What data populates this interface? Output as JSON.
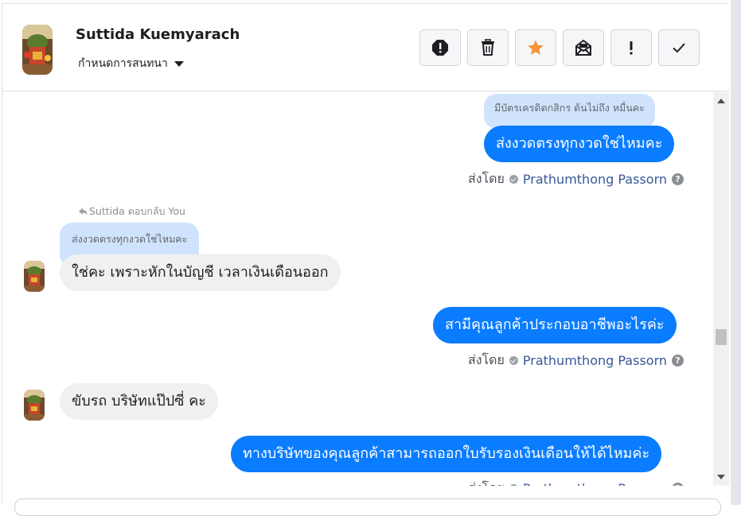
{
  "header": {
    "contact_name": "Suttida Kuemyarach",
    "assign_label": "กำหนดการสนทนา",
    "toolbar": [
      {
        "name": "spam-button",
        "icon": "alert-octagon-icon"
      },
      {
        "name": "delete-button",
        "icon": "trash-icon"
      },
      {
        "name": "star-button",
        "icon": "star-icon",
        "color": "#f7923a"
      },
      {
        "name": "mark-unread-button",
        "icon": "envelope-icon"
      },
      {
        "name": "follow-up-button",
        "icon": "exclamation-icon"
      },
      {
        "name": "mark-done-button",
        "icon": "checkmark-icon"
      }
    ]
  },
  "messages": {
    "m1_quote": "มีบัตรเครดิตกสิกร ต้นไม่ถึง หมื่นคะ",
    "m1_text": "ส่งงวดตรงทุกงวดใช่ไหมคะ",
    "sent_by_label": "ส่งโดย",
    "agent_name": "Prathumthong Passorn",
    "reply_label": "Suttida ตอบกลับ You",
    "m2_quote": "ส่งงวดตรงทุกงวดใช่ไหมคะ",
    "m2_text": "ใช่คะ เพราะหักในบัญชี เวลาเงินเดือนออก",
    "m3_text": "สามีคุณลูกค้าประกอบอาชีพอะไรค่ะ",
    "m4_text": "ขับรถ บริษัทแป๊ปซี่ คะ",
    "m5_text": "ทางบริษัทของคุณลูกค้าสามารถออกใบรับรองเงินเดือนให้ได้ไหมค่ะ"
  },
  "colors": {
    "outgoing_bubble": "#0a7cff",
    "incoming_bubble": "#f0f0f0",
    "quote_bubble": "#cfe3fd",
    "agent_link": "#385898",
    "star": "#f7923a"
  }
}
